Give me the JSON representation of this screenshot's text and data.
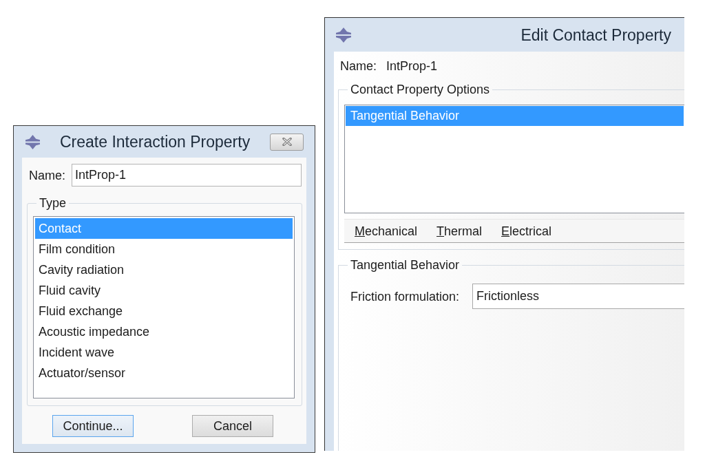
{
  "create_dialog": {
    "title": "Create Interaction Property",
    "name_label": "Name:",
    "name_value": "IntProp-1",
    "type_group": {
      "title": "Type",
      "items": [
        {
          "label": "Contact",
          "selected": true
        },
        {
          "label": "Film condition",
          "selected": false
        },
        {
          "label": "Cavity radiation",
          "selected": false
        },
        {
          "label": "Fluid cavity",
          "selected": false
        },
        {
          "label": "Fluid exchange",
          "selected": false
        },
        {
          "label": "Acoustic impedance",
          "selected": false
        },
        {
          "label": "Incident wave",
          "selected": false
        },
        {
          "label": "Actuator/sensor",
          "selected": false
        }
      ]
    },
    "buttons": [
      {
        "label": "Continue...",
        "focused": true
      },
      {
        "label": "Cancel",
        "focused": false
      }
    ]
  },
  "edit_dialog": {
    "title": "Edit Contact Property",
    "name_label": "Name:",
    "name_value": "IntProp-1",
    "options_group": {
      "title": "Contact Property Options",
      "items": [
        {
          "label": "Tangential Behavior",
          "selected": true
        }
      ],
      "menus": [
        {
          "label": "Mechanical"
        },
        {
          "label": "Thermal"
        },
        {
          "label": "Electrical"
        }
      ]
    },
    "behavior_group": {
      "title": "Tangential Behavior",
      "fields": [
        {
          "label": "Friction formulation:",
          "value": "Frictionless"
        }
      ]
    }
  }
}
